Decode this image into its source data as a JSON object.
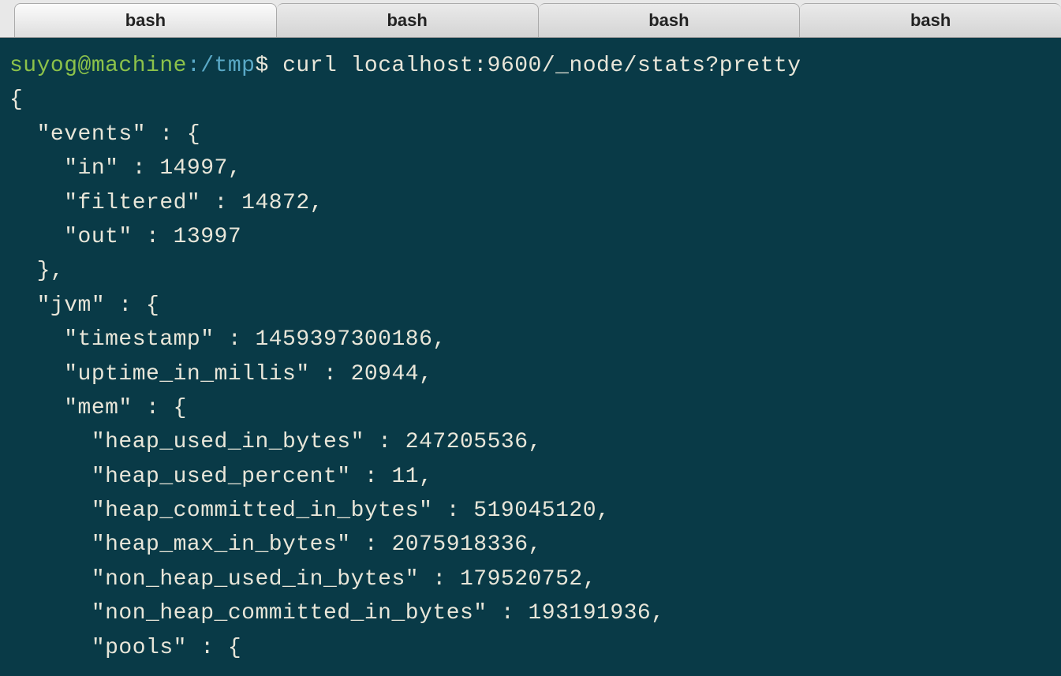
{
  "tabs": [
    {
      "label": "bash"
    },
    {
      "label": "bash"
    },
    {
      "label": "bash"
    },
    {
      "label": "bash"
    }
  ],
  "prompt": {
    "user": "suyog",
    "at": "@",
    "host": "machine",
    "path": ":/tmp",
    "symbol": "$",
    "command": "curl localhost:9600/_node/stats?pretty"
  },
  "output_lines": [
    "{",
    "  \"events\" : {",
    "    \"in\" : 14997,",
    "    \"filtered\" : 14872,",
    "    \"out\" : 13997",
    "  },",
    "  \"jvm\" : {",
    "    \"timestamp\" : 1459397300186,",
    "    \"uptime_in_millis\" : 20944,",
    "    \"mem\" : {",
    "      \"heap_used_in_bytes\" : 247205536,",
    "      \"heap_used_percent\" : 11,",
    "      \"heap_committed_in_bytes\" : 519045120,",
    "      \"heap_max_in_bytes\" : 2075918336,",
    "      \"non_heap_used_in_bytes\" : 179520752,",
    "      \"non_heap_committed_in_bytes\" : 193191936,",
    "      \"pools\" : {"
  ]
}
